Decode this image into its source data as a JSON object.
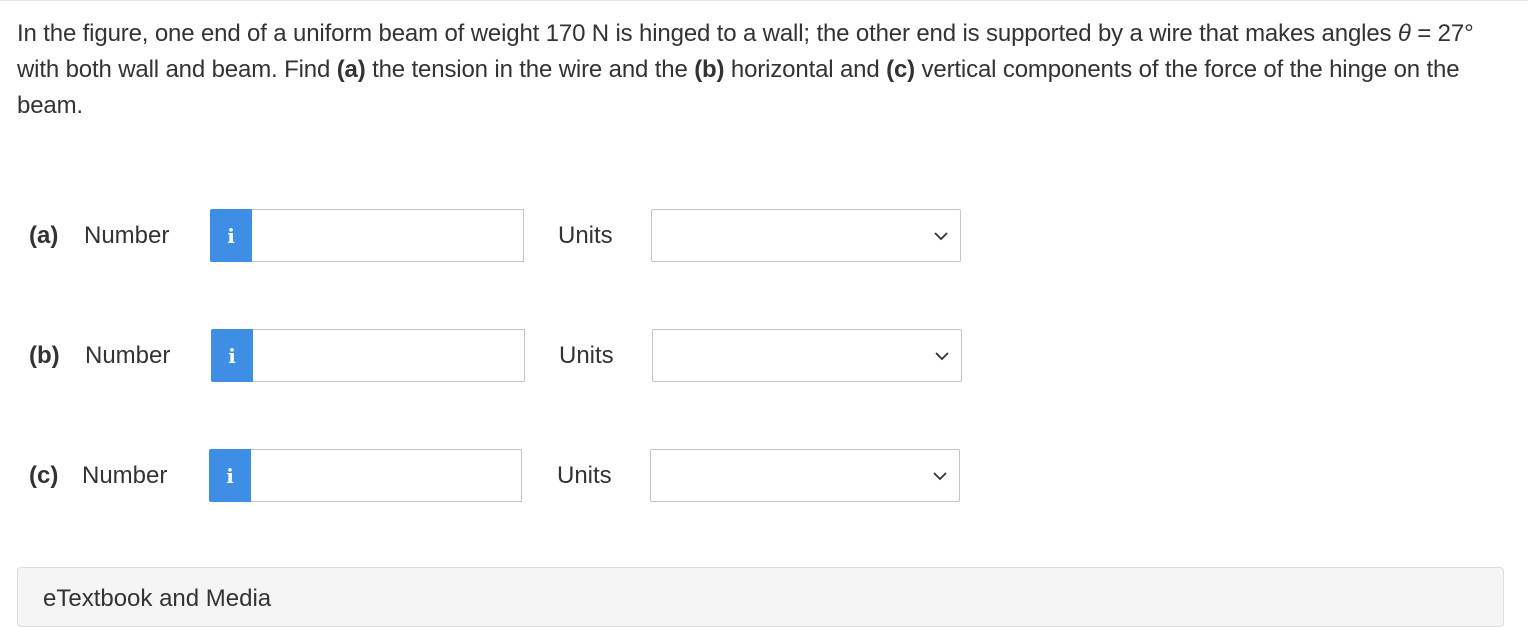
{
  "question": {
    "seg1": "In the figure, one end of a uniform beam of weight 170 N is hinged to a wall; the other end is supported by a wire that makes angles ",
    "theta": "θ",
    "seg2": " = 27° with both wall and beam. Find ",
    "part_a_tag": "(a)",
    "seg3": " the tension in the wire and the ",
    "part_b_tag": "(b)",
    "seg4": " horizontal and ",
    "part_c_tag": "(c)",
    "seg5": " vertical components of the force of the hinge on the beam."
  },
  "answers": [
    {
      "part": "(a)",
      "number_label": "Number",
      "info_icon": "i",
      "value": "",
      "units_label": "Units",
      "units_value": ""
    },
    {
      "part": "(b)",
      "number_label": "Number",
      "info_icon": "i",
      "value": "",
      "units_label": "Units",
      "units_value": ""
    },
    {
      "part": "(c)",
      "number_label": "Number",
      "info_icon": "i",
      "value": "",
      "units_label": "Units",
      "units_value": ""
    }
  ],
  "colors": {
    "info_button": "#3d8ee4",
    "text": "#333333",
    "border": "#c4c4c4"
  },
  "media_panel": {
    "title": "eTextbook and Media"
  }
}
